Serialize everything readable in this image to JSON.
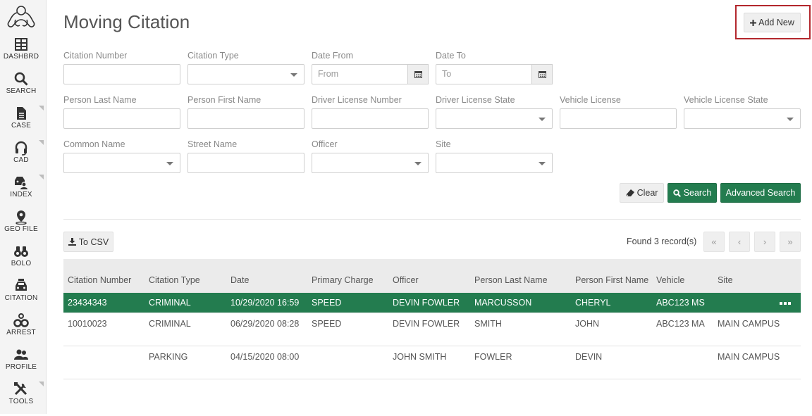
{
  "sidebar": {
    "items": [
      {
        "label": "DASHBRD",
        "icon": "dashboard-icon",
        "expandable": false
      },
      {
        "label": "SEARCH",
        "icon": "search-icon",
        "expandable": false
      },
      {
        "label": "CASE",
        "icon": "document-icon",
        "expandable": true
      },
      {
        "label": "CAD",
        "icon": "headset-icon",
        "expandable": true
      },
      {
        "label": "INDEX",
        "icon": "person-car-icon",
        "expandable": true
      },
      {
        "label": "GEO FILE",
        "icon": "map-pin-icon",
        "expandable": false
      },
      {
        "label": "BOLO",
        "icon": "binoculars-icon",
        "expandable": false
      },
      {
        "label": "CITATION",
        "icon": "car-icon",
        "expandable": false
      },
      {
        "label": "ARREST",
        "icon": "handcuffs-icon",
        "expandable": false
      },
      {
        "label": "PROFILE",
        "icon": "users-icon",
        "expandable": false
      },
      {
        "label": "TOOLS",
        "icon": "tools-icon",
        "expandable": true
      }
    ]
  },
  "page": {
    "title": "Moving Citation",
    "add_new_label": "Add New"
  },
  "filters": {
    "citation_number": {
      "label": "Citation Number",
      "value": ""
    },
    "citation_type": {
      "label": "Citation Type",
      "value": ""
    },
    "date_from": {
      "label": "Date From",
      "placeholder": "From"
    },
    "date_to": {
      "label": "Date To",
      "placeholder": "To"
    },
    "person_last_name": {
      "label": "Person Last Name",
      "value": ""
    },
    "person_first_name": {
      "label": "Person First Name",
      "value": ""
    },
    "driver_license_number": {
      "label": "Driver License Number",
      "value": ""
    },
    "driver_license_state": {
      "label": "Driver License State",
      "value": ""
    },
    "vehicle_license": {
      "label": "Vehicle License",
      "value": ""
    },
    "vehicle_license_state": {
      "label": "Vehicle License State",
      "value": ""
    },
    "common_name": {
      "label": "Common Name",
      "value": ""
    },
    "street_name": {
      "label": "Street Name",
      "value": ""
    },
    "officer": {
      "label": "Officer",
      "value": ""
    },
    "site": {
      "label": "Site",
      "value": ""
    }
  },
  "actions": {
    "clear_label": "Clear",
    "search_label": "Search",
    "advanced_search_label": "Advanced Search",
    "csv_label": "To CSV",
    "found_text": "Found 3 record(s)"
  },
  "table": {
    "columns": [
      "Citation Number",
      "Citation Type",
      "Date",
      "Primary Charge",
      "Officer",
      "Person Last Name",
      "Person First Name",
      "Vehicle",
      "Site"
    ],
    "rows": [
      [
        "23434343",
        "CRIMINAL",
        "10/29/2020 16:59",
        "SPEED",
        "DEVIN FOWLER",
        "MARCUSSON",
        "CHERYL",
        "ABC123 MS",
        ""
      ],
      [
        "10010023",
        "CRIMINAL",
        "06/29/2020 08:28",
        "SPEED",
        "DEVIN FOWLER",
        "SMITH",
        "JOHN",
        "ABC123 MA",
        "MAIN CAMPUS"
      ],
      [
        "",
        "PARKING",
        "04/15/2020 08:00",
        "",
        "JOHN SMITH",
        "FOWLER",
        "DEVIN",
        "",
        "MAIN CAMPUS"
      ]
    ],
    "selected_row": 0
  },
  "colors": {
    "accent_green": "#237c4f",
    "highlight_red": "#b3272d"
  }
}
